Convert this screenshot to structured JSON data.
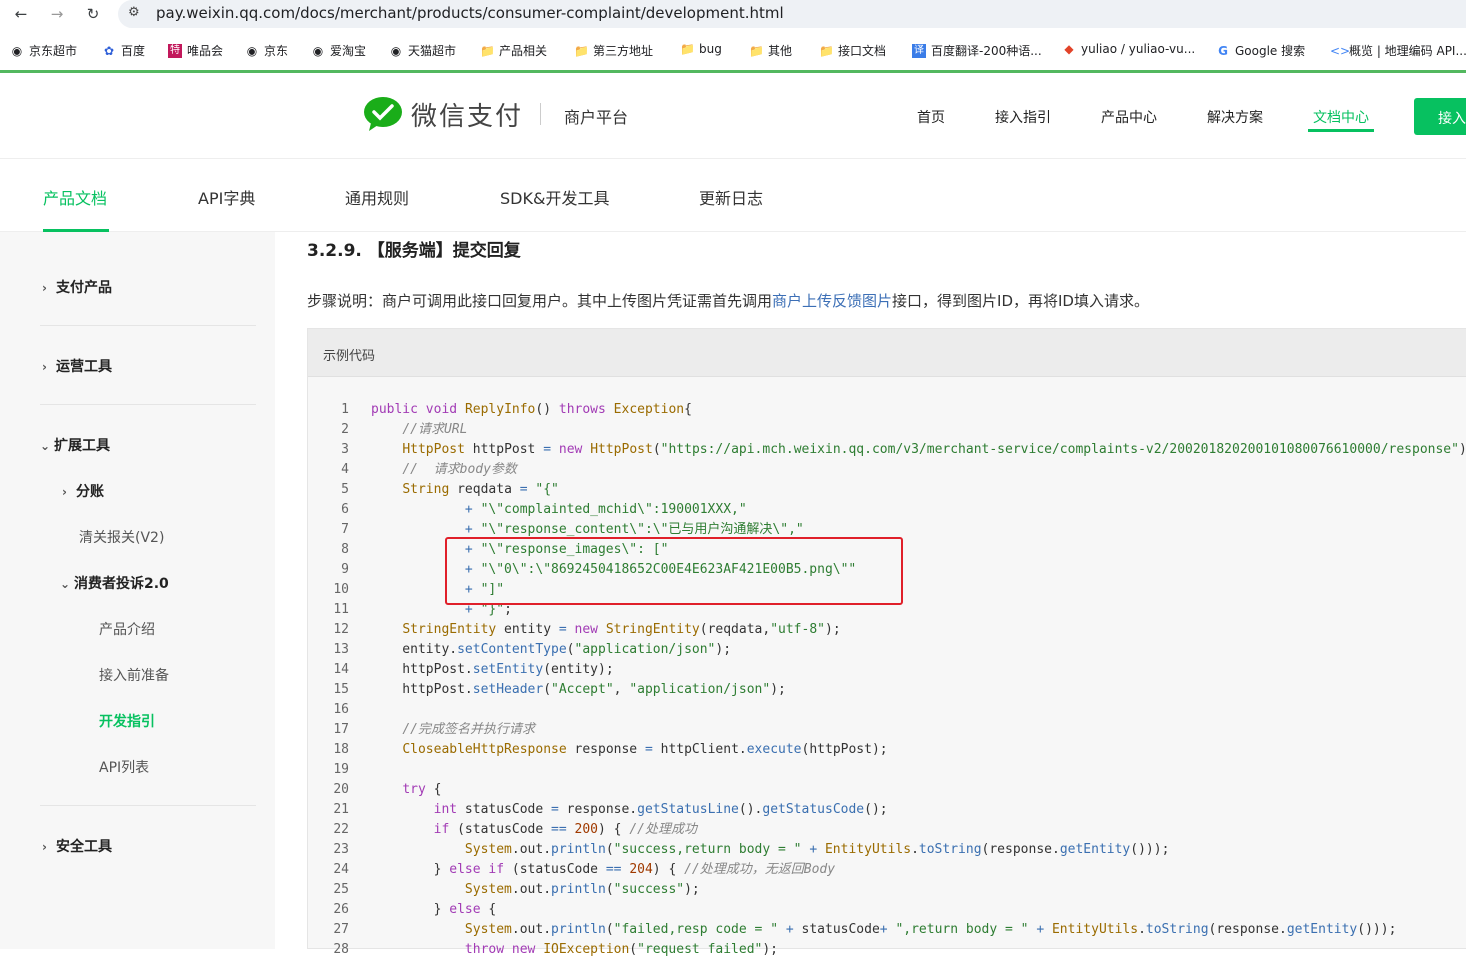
{
  "browser": {
    "url": "pay.weixin.qq.com/docs/merchant/products/consumer-complaint/development.html",
    "bookmarks": [
      "京东超市",
      "百度",
      "唯品会",
      "京东",
      "爱淘宝",
      "天猫超市",
      "产品相关",
      "第三方地址",
      "bug",
      "其他",
      "接口文档",
      "百度翻译-200种语...",
      "yuliao / yuliao-vu...",
      "Google 搜索",
      "概览 | 地理编码 API..."
    ]
  },
  "header": {
    "logo_text": "微信支付",
    "platform": "商户平台",
    "nav": [
      "首页",
      "接入指引",
      "产品中心",
      "解决方案",
      "文档中心"
    ],
    "join": "接入"
  },
  "doc_tabs": [
    "产品文档",
    "API字典",
    "通用规则",
    "SDK&开发工具",
    "更新日志"
  ],
  "sidebar": {
    "pay_products": "支付产品",
    "ops_tools": "运营工具",
    "ext_tools": "扩展工具",
    "fenzhang": "分账",
    "customs": "清关报关(V2)",
    "complaint": "消费者投诉2.0",
    "intro": "产品介绍",
    "prep": "接入前准备",
    "dev": "开发指引",
    "api": "API列表",
    "security": "安全工具"
  },
  "content": {
    "heading": "3.2.9. 【服务端】提交回复",
    "step_before": "步骤说明：商户可调用此接口回复用户。其中上传图片凭证需首先调用",
    "step_link": "商户上传反馈图片",
    "step_after": "接口，得到图片ID，再将ID填入请求。",
    "code_title": "示例代码"
  },
  "code_lines": [
    "1",
    "2",
    "3",
    "4",
    "5",
    "6",
    "7",
    "8",
    "9",
    "10",
    "11",
    "12",
    "13",
    "14",
    "15",
    "16",
    "17",
    "18",
    "19",
    "20",
    "21",
    "22",
    "23",
    "24",
    "25",
    "26",
    "27",
    "28"
  ]
}
